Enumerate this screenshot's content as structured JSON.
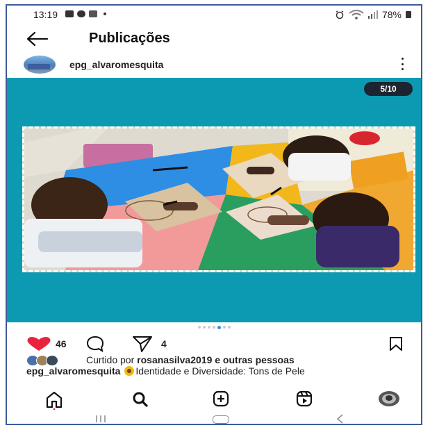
{
  "status_bar": {
    "time": "13:19",
    "battery": "78%",
    "icons": [
      "image-icon",
      "chat-icon",
      "s-icon",
      "alarm-icon",
      "wifi-icon",
      "signal-icon",
      "battery-icon"
    ]
  },
  "header": {
    "title": "Publicações",
    "back_icon": "arrow-left-icon"
  },
  "post": {
    "username": "epg_alvaromesquita",
    "menu_icon": "more-vertical-icon",
    "media_counter": "5/10",
    "carousel_total_dots": 7,
    "carousel_active_dot": 5,
    "likes": "46",
    "shares": "4",
    "liked_by_prefix": "Curtido por",
    "liked_by_user": "rosanasilva2019",
    "liked_by_suffix": "e outras pessoas",
    "caption_user": "epg_alvaromesquita",
    "caption_text": "Identidade e Diversidade: Tons de Pele",
    "media_background": "#0b9ab1"
  },
  "tabs": [
    {
      "name": "home-icon"
    },
    {
      "name": "search-icon"
    },
    {
      "name": "create-icon"
    },
    {
      "name": "reels-icon"
    },
    {
      "name": "profile-avatar"
    }
  ],
  "colors": {
    "heart": "#e8243c",
    "accent_dot": "#3f8fd8",
    "frame_border": "#3b5a9a"
  }
}
